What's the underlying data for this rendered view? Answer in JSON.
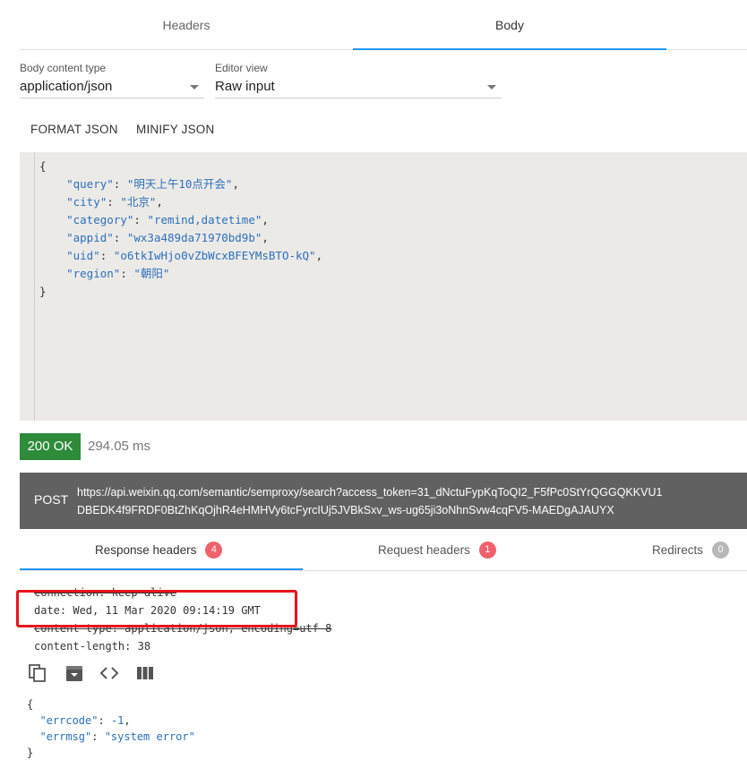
{
  "tabs": {
    "headers": "Headers",
    "body": "Body"
  },
  "body_content_type": {
    "label": "Body content type",
    "value": "application/json"
  },
  "editor_view": {
    "label": "Editor view",
    "value": "Raw input"
  },
  "json_actions": {
    "format": "FORMAT JSON",
    "minify": "MINIFY JSON"
  },
  "request_body": {
    "open": "{",
    "close": "}",
    "fields": [
      {
        "key": "\"query\"",
        "value": "\"明天上午10点开会\"",
        "sep": ","
      },
      {
        "key": "\"city\"",
        "value": "\"北京\"",
        "sep": ","
      },
      {
        "key": "\"category\"",
        "value": "\"remind,datetime\"",
        "sep": ","
      },
      {
        "key": "\"appid\"",
        "value": "\"wx3a489da71970bd9b\"",
        "sep": ","
      },
      {
        "key": "\"uid\"",
        "value": "\"o6tkIwHjo0vZbWcxBFEYMsBTO-kQ\"",
        "sep": ","
      },
      {
        "key": "\"region\"",
        "value": "\"朝阳\"",
        "sep": ""
      }
    ]
  },
  "response": {
    "status": "200 OK",
    "time": "294.05 ms",
    "method": "POST",
    "url_line1": "https://api.weixin.qq.com/semantic/semproxy/search?access_token=31_dNctuFypKqToQI2_F5fPc0StYrQGGQKKVU1",
    "url_line2": "DBEDK4f9FRDF0BtZhKqOjhR4eHMHVy6tcFyrcIUj5JVBkSxv_ws-ug65ji3oNhnSvw4cqFV5-MAEDgAJAUYX"
  },
  "response_tabs": [
    {
      "label": "Response headers",
      "count": "4"
    },
    {
      "label": "Request headers",
      "count": "1"
    },
    {
      "label": "Redirects",
      "count": "0"
    }
  ],
  "response_headers": {
    "connection": "connection: keep-alive",
    "date": "date: Wed, 11 Mar 2020 09:14:19 GMT",
    "content_type": "content-type: application/json; encoding=utf-8",
    "content_length": "content-length: 38"
  },
  "response_body": {
    "open": "{",
    "close": "}",
    "errcode_key": "\"errcode\"",
    "errcode_value": "-1",
    "errmsg_key": "\"errmsg\"",
    "errmsg_value": "\"system error\""
  },
  "icons": [
    "copy-icon",
    "save-icon",
    "code-view-icon",
    "columns-icon"
  ],
  "colors": {
    "accent": "#2196f3",
    "success": "#2e8b3a",
    "highlight": "#e8141c",
    "badge": "#f0626b"
  }
}
